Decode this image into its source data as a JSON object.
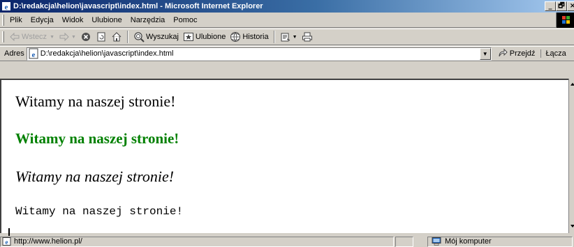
{
  "window": {
    "title": "D:\\redakcja\\helion\\javascript\\index.html - Microsoft Internet Explorer",
    "controls": [
      "_",
      "🗗",
      "×"
    ]
  },
  "menu": {
    "items": [
      "Plik",
      "Edycja",
      "Widok",
      "Ulubione",
      "Narzędzia",
      "Pomoc"
    ]
  },
  "toolbar": {
    "back_label": "Wstecz",
    "search_label": "Wyszukaj",
    "favorites_label": "Ulubione",
    "history_label": "Historia"
  },
  "address": {
    "label": "Adres",
    "url": "D:\\redakcja\\helion\\javascript\\index.html",
    "go_label": "Przejdź",
    "links_label": "Łącza"
  },
  "page": {
    "lines": [
      "Witamy na naszej stronie!",
      "Witamy na naszej stronie!",
      "Witamy na naszej stronie!",
      "Witamy na naszej stronie!"
    ]
  },
  "status": {
    "text": "http://www.helion.pl/",
    "zone": "Mój komputer"
  },
  "colors": {
    "titlebar_start": "#0a246a",
    "titlebar_end": "#a6caf0",
    "chrome": "#d4d0c8",
    "green_text": "#008000"
  },
  "icons": {
    "title": "ie-icon",
    "back": "back-arrow-icon",
    "forward": "forward-arrow-icon",
    "stop": "stop-icon",
    "refresh": "refresh-icon",
    "home": "home-icon",
    "search": "search-icon",
    "favorites": "favorites-icon",
    "history": "history-icon",
    "mail": "mail-icon",
    "print": "print-icon",
    "go": "go-arrow-icon",
    "status_page": "page-icon",
    "zone": "computer-icon"
  }
}
